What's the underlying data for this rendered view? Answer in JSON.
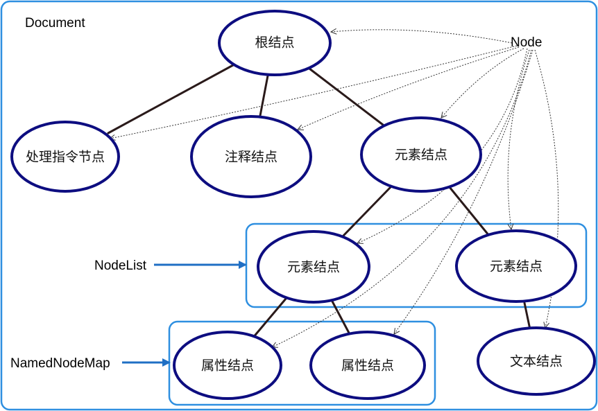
{
  "labels": {
    "document": "Document",
    "node": "Node",
    "nodelist": "NodeList",
    "namednodemap": "NamedNodeMap"
  },
  "nodes": {
    "root": "根结点",
    "pi": "处理指令节点",
    "comment": "注释结点",
    "element": "元素结点",
    "child_element_1": "元素结点",
    "child_element_2": "元素结点",
    "attr_1": "属性结点",
    "attr_2": "属性结点",
    "text": "文本结点"
  },
  "colors": {
    "outer_border": "#2e8fe0",
    "group_border": "#2e8fe0",
    "ellipse_stroke": "#0d0d80",
    "tree_edge": "#2a1a1a",
    "pointer_arrow": "#1f6fc4",
    "dotted_arrow": "#333333"
  }
}
